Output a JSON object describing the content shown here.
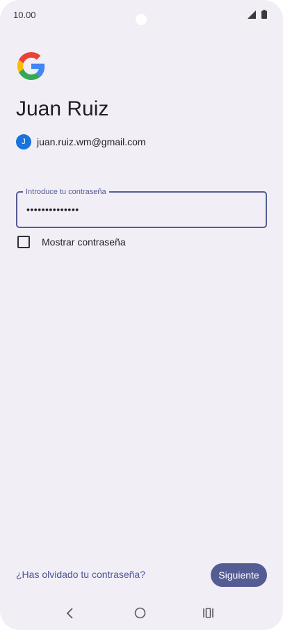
{
  "status_bar": {
    "time": "10.00",
    "icons": [
      "signal-icon",
      "battery-icon"
    ]
  },
  "logo": "google-logo-icon",
  "account": {
    "name": "Juan Ruiz",
    "avatar_letter": "J",
    "email": "juan.ruiz.wm@gmail.com",
    "avatar_color": "#1a73d9"
  },
  "password": {
    "label": "Introduce tu contraseña",
    "value": "••••••••••••••"
  },
  "show_password": {
    "label": "Mostrar contraseña",
    "checked": false
  },
  "footer": {
    "forgot_label": "¿Has olvidado tu contraseña?",
    "next_label": "Siguiente"
  },
  "nav_bar": {
    "icons": [
      "back-icon",
      "home-icon",
      "recents-icon"
    ]
  },
  "colors": {
    "accent": "#555c94",
    "background": "#f1eef6",
    "link": "#4b5398"
  }
}
